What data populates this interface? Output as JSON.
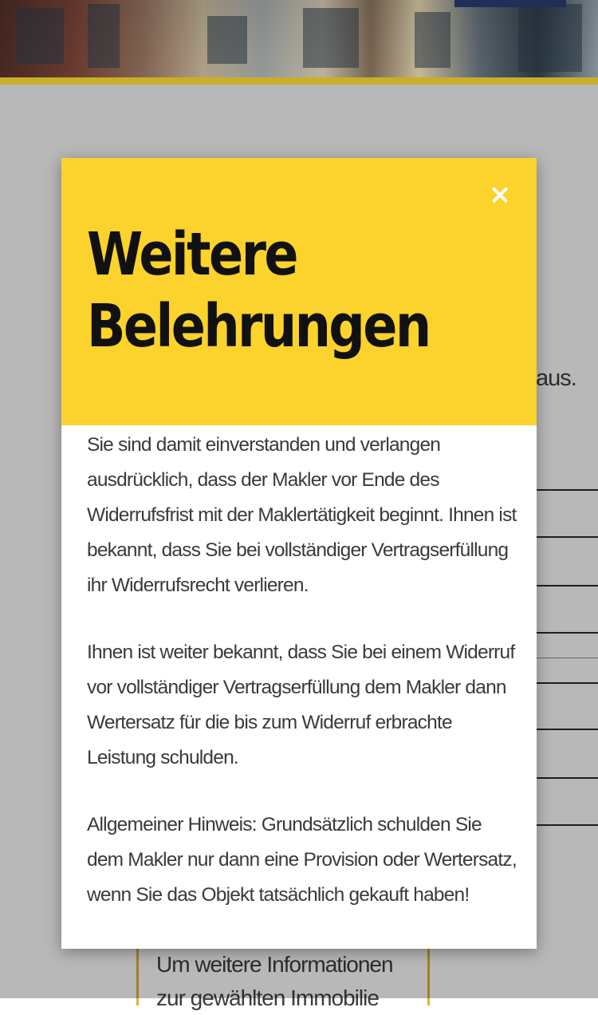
{
  "background_page": {
    "partial_text_right": "aus.",
    "info_box_text": "Um weitere Informationen zur gewählten Immobilie"
  },
  "modal": {
    "title": "Weitere Belehrungen",
    "close_glyph": "×",
    "paragraphs": [
      "Sie sind damit einverstanden und verlangen ausdrücklich, dass der Makler vor Ende des Widerrufsfrist mit der Maklertätigkeit beginnt. Ihnen ist bekannt, dass Sie bei vollständiger Vertragserfüllung ihr Widerrufsrecht verlieren.",
      "Ihnen ist weiter bekannt, dass Sie bei einem Widerruf vor vollständiger Vertragserfüllung dem Makler dann Wertersatz für die bis zum Widerruf erbrachte Leistung schulden.",
      "Allgemeiner Hinweis: Grundsätzlich schulden Sie dem Makler nur dann eine Provision oder Wertersatz, wenn Sie das Objekt tatsächlich gekauft haben!"
    ]
  },
  "colors": {
    "modal_header": "#fcd22c",
    "accent_rule": "#c9ae2b",
    "hero_button": "#1f2f57"
  },
  "icons": {
    "close": "close-icon"
  }
}
